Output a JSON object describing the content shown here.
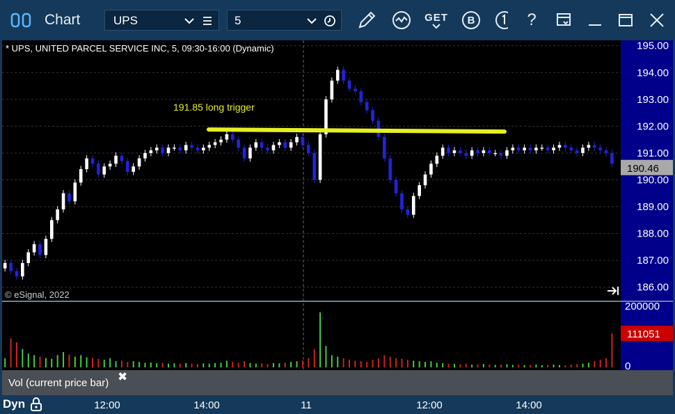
{
  "app": {
    "title": "Chart"
  },
  "toolbar": {
    "symbol": "UPS",
    "interval": "5",
    "icons": [
      "layout-icon",
      "symbol-menu-icon",
      "clock-icon",
      "draw-pencil-icon",
      "study-icon",
      "get-data-icon",
      "bitcoin-icon",
      "info-icon",
      "help-icon",
      "window-menu-icon",
      "minimize-icon",
      "maximize-icon",
      "close-icon"
    ],
    "get_label": "GET",
    "b_label": "B",
    "help_label": "?"
  },
  "chart": {
    "header": "* UPS, UNITED PARCEL SERVICE INC, 5, 09:30-16:00 (Dynamic)",
    "copyright": "© eSignal, 2022",
    "annotation": "191.85 long trigger",
    "last_price": "190.46",
    "last_volume": "111051",
    "study_label": "Vol (current price bar)",
    "study_close": "✖",
    "bottom_mode": "Dyn",
    "colors": {
      "background": "#000000",
      "axis": "#00008b",
      "frame": "#14395a",
      "up": "#ffffff",
      "down": "#2222dd",
      "trigger": "#e6f020",
      "vol_up": "#44cc44",
      "vol_down": "#cc2222",
      "price_box": "#a9a9a9",
      "vol_box": "#cc0000"
    }
  },
  "chart_data": [
    {
      "type": "candlestick",
      "title": "* UPS, UNITED PARCEL SERVICE INC, 5, 09:30-16:00 (Dynamic)",
      "ylim": [
        185.5,
        195.2
      ],
      "y_ticks": [
        "195.00",
        "194.00",
        "193.00",
        "192.00",
        "191.00",
        "190.00",
        "189.00",
        "188.00",
        "187.00",
        "186.00"
      ],
      "x_ticks": [
        "12:00",
        "14:00",
        "11",
        "12:00",
        "14:00"
      ],
      "series_close": [
        186.9,
        186.6,
        186.4,
        186.9,
        187.3,
        187.6,
        187.2,
        187.8,
        188.5,
        188.9,
        189.5,
        189.2,
        189.9,
        190.4,
        190.8,
        190.6,
        190.2,
        190.5,
        190.6,
        190.9,
        190.7,
        190.3,
        190.5,
        190.8,
        191.0,
        191.1,
        191.2,
        191.0,
        191.2,
        191.2,
        191.1,
        191.3,
        191.2,
        191.1,
        191.2,
        191.3,
        191.4,
        191.5,
        191.7,
        191.5,
        191.2,
        190.8,
        191.2,
        191.4,
        191.2,
        191.1,
        191.3,
        191.4,
        191.2,
        191.4,
        191.6,
        191.3,
        191.0,
        190.0,
        191.7,
        193.0,
        193.7,
        194.1,
        193.7,
        193.4,
        193.3,
        192.9,
        192.6,
        192.2,
        191.6,
        190.8,
        190.0,
        189.5,
        188.9,
        188.7,
        189.4,
        189.8,
        190.2,
        190.6,
        190.9,
        191.2,
        191.0,
        191.1,
        191.0,
        190.9,
        191.1,
        191.0,
        191.1,
        191.0,
        191.0,
        190.9,
        191.1,
        191.2,
        191.1,
        191.2,
        191.1,
        191.2,
        191.2,
        191.1,
        191.2,
        191.3,
        191.2,
        191.1,
        191.0,
        191.2,
        191.3,
        191.2,
        191.1,
        191.0,
        190.6
      ],
      "horizontal_line": {
        "label": "191.85 long trigger",
        "value": 191.85
      },
      "last_value": 190.46
    },
    {
      "type": "bar",
      "title": "Vol (current price bar)",
      "ylim": [
        0,
        200000
      ],
      "y_ticks": [
        "200000",
        "0"
      ],
      "last_value": 111051,
      "values": [
        30000,
        95000,
        82000,
        60000,
        45000,
        40000,
        35000,
        30000,
        28000,
        40000,
        50000,
        42000,
        35000,
        40000,
        33000,
        30000,
        28000,
        25000,
        30000,
        20000,
        22000,
        18000,
        20000,
        18000,
        15000,
        16000,
        14000,
        15000,
        12000,
        13000,
        12000,
        14000,
        12000,
        11000,
        13000,
        12000,
        14000,
        15000,
        22000,
        18000,
        15000,
        20000,
        14000,
        12000,
        13000,
        11000,
        14000,
        13000,
        15000,
        18000,
        20000,
        22000,
        30000,
        60000,
        180000,
        70000,
        40000,
        35000,
        30000,
        25000,
        22000,
        20000,
        18000,
        25000,
        30000,
        40000,
        35000,
        30000,
        28000,
        25000,
        22000,
        20000,
        18000,
        20000,
        15000,
        14000,
        12000,
        11000,
        10000,
        12000,
        9000,
        10000,
        11000,
        9000,
        8000,
        9000,
        10000,
        8000,
        9000,
        7000,
        8000,
        9000,
        7000,
        8000,
        9000,
        8000,
        7000,
        9000,
        10000,
        12000,
        15000,
        20000,
        25000,
        30000,
        111051
      ]
    }
  ]
}
